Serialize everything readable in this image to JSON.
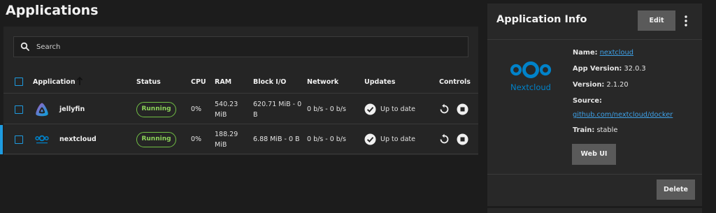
{
  "page": {
    "title": "Applications"
  },
  "search": {
    "placeholder": "Search"
  },
  "table": {
    "headers": {
      "application": "Application",
      "status": "Status",
      "cpu": "CPU",
      "ram": "RAM",
      "block_io": "Block I/O",
      "network": "Network",
      "updates": "Updates",
      "controls": "Controls"
    },
    "rows": [
      {
        "name": "jellyfin",
        "icon": "jellyfin-logo-icon",
        "status": "Running",
        "cpu": "0%",
        "ram_line1": "540.23",
        "ram_line2": "MiB",
        "block_line1": "620.71 MiB - 0",
        "block_line2": "B",
        "network": "0 b/s - 0 b/s",
        "updates": "Up to date"
      },
      {
        "name": "nextcloud",
        "icon": "nextcloud-logo-icon",
        "status": "Running",
        "cpu": "0%",
        "ram_line1": "188.29",
        "ram_line2": "MiB",
        "block_line1": "6.88 MiB - 0 B",
        "block_line2": "",
        "network": "0 b/s - 0 b/s",
        "updates": "Up to date",
        "selected": true
      }
    ]
  },
  "info": {
    "title": "Application Info",
    "edit_label": "Edit",
    "logo_text": "Nextcloud",
    "name_label": "Name:",
    "name_value": "nextcloud",
    "app_version_label": "App Version:",
    "app_version_value": "32.0.3",
    "version_label": "Version:",
    "version_value": "2.1.20",
    "source_label": "Source:",
    "source_value": "github.com/nextcloud/docker",
    "train_label": "Train:",
    "train_value": "stable",
    "webui_label": "Web UI",
    "delete_label": "Delete"
  },
  "colors": {
    "accent": "#1e9be0",
    "running": "#71bf44",
    "nextcloud": "#0082c9"
  }
}
